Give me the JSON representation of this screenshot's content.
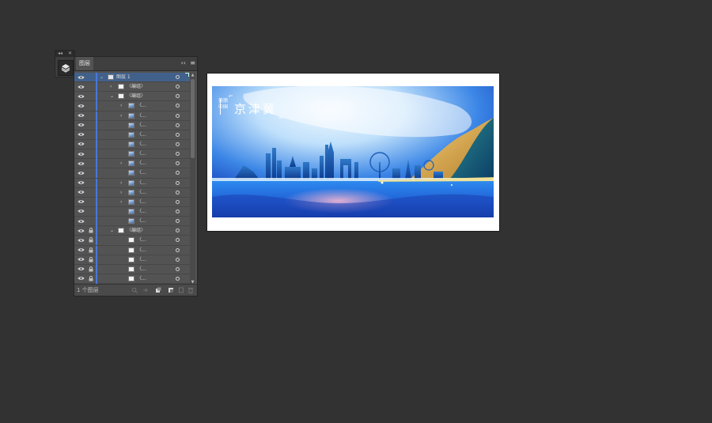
{
  "toolstrip": {
    "collapse_glyph": "◂◂",
    "close_glyph": "✕",
    "layers_icon": "layers-icon"
  },
  "layers_panel": {
    "tab_label": "图层",
    "collapse_glyph": "‹‹",
    "menu_glyph": "≡",
    "layer_count_label": "1 个图层",
    "rows": [
      {
        "name": "图层 1",
        "kind": "layer",
        "depth": 0,
        "expanded": true,
        "selected": true,
        "locked": false
      },
      {
        "name": "〈编组〉",
        "kind": "group",
        "depth": 1,
        "expanded": false,
        "selected": false,
        "locked": false
      },
      {
        "name": "〈编组〉",
        "kind": "group",
        "depth": 1,
        "expanded": true,
        "selected": false,
        "locked": false
      },
      {
        "name": "〈...",
        "kind": "pic",
        "depth": 2,
        "expanded": false,
        "selected": false,
        "locked": false
      },
      {
        "name": "〈...",
        "kind": "pic",
        "depth": 2,
        "expanded": false,
        "selected": false,
        "locked": false
      },
      {
        "name": "〈...",
        "kind": "pic",
        "depth": 2,
        "expanded": null,
        "selected": false,
        "locked": false
      },
      {
        "name": "〈...",
        "kind": "pic",
        "depth": 2,
        "expanded": null,
        "selected": false,
        "locked": false
      },
      {
        "name": "〈...",
        "kind": "pic",
        "depth": 2,
        "expanded": null,
        "selected": false,
        "locked": false
      },
      {
        "name": "〈...",
        "kind": "pic",
        "depth": 2,
        "expanded": null,
        "selected": false,
        "locked": false
      },
      {
        "name": "〈...",
        "kind": "pic",
        "depth": 2,
        "expanded": false,
        "selected": false,
        "locked": false
      },
      {
        "name": "〈...",
        "kind": "pic",
        "depth": 2,
        "expanded": null,
        "selected": false,
        "locked": false
      },
      {
        "name": "〈...",
        "kind": "pic",
        "depth": 2,
        "expanded": false,
        "selected": false,
        "locked": false
      },
      {
        "name": "〈...",
        "kind": "pic",
        "depth": 2,
        "expanded": false,
        "selected": false,
        "locked": false
      },
      {
        "name": "〈...",
        "kind": "pic",
        "depth": 2,
        "expanded": false,
        "selected": false,
        "locked": false
      },
      {
        "name": "〈...",
        "kind": "pic",
        "depth": 2,
        "expanded": null,
        "selected": false,
        "locked": false
      },
      {
        "name": "〈...",
        "kind": "pic",
        "depth": 2,
        "expanded": null,
        "selected": false,
        "locked": false
      },
      {
        "name": "〈编组〉",
        "kind": "group",
        "depth": 1,
        "expanded": true,
        "selected": false,
        "locked": true
      },
      {
        "name": "〈...",
        "kind": "blank",
        "depth": 2,
        "expanded": null,
        "selected": false,
        "locked": true
      },
      {
        "name": "〈...",
        "kind": "blank",
        "depth": 2,
        "expanded": null,
        "selected": false,
        "locked": true
      },
      {
        "name": "〈...",
        "kind": "blank",
        "depth": 2,
        "expanded": null,
        "selected": false,
        "locked": true
      },
      {
        "name": "〈...",
        "kind": "blank",
        "depth": 2,
        "expanded": null,
        "selected": false,
        "locked": true
      },
      {
        "name": "〈...",
        "kind": "blank",
        "depth": 2,
        "expanded": null,
        "selected": false,
        "locked": true
      }
    ],
    "footer_icons": [
      "locate-object-icon",
      "collect-export-icon",
      "make-clipping-mask-icon",
      "new-sublayer-icon",
      "new-layer-icon",
      "delete-icon"
    ]
  },
  "artwork": {
    "subtitle_lines": [
      "美丽",
      "中国"
    ],
    "title": "京津冀",
    "colors": {
      "sky_top": "#1a4fc4",
      "sky_light": "#eaf4ff",
      "water": "#1f7fe0",
      "gold": "#d9a447",
      "teal": "#1a6e86"
    }
  },
  "colors": {
    "canvas_bg": "#323232",
    "panel_bg": "#535353",
    "selection": "#41618a",
    "layer_bar": "#4a78d6"
  }
}
